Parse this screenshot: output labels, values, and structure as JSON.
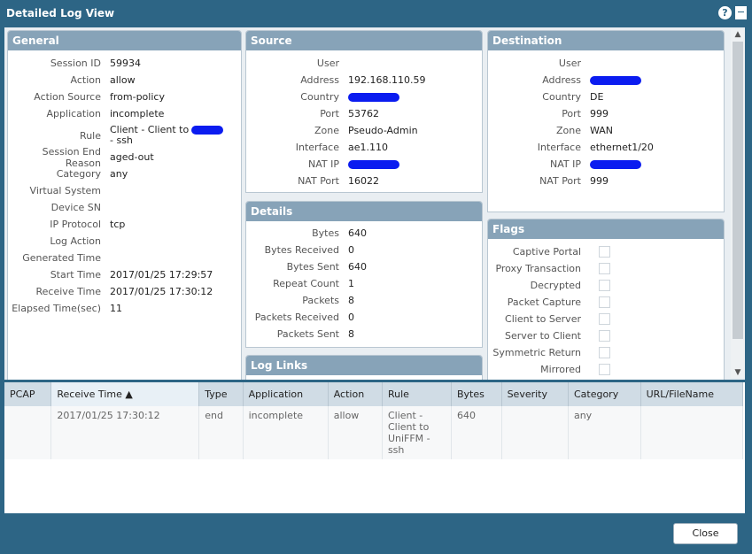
{
  "window": {
    "title": "Detailed Log View"
  },
  "general": {
    "title": "General",
    "rows": [
      {
        "label": "Session ID",
        "value": "59934"
      },
      {
        "label": "Action",
        "value": "allow"
      },
      {
        "label": "Action Source",
        "value": "from-policy"
      },
      {
        "label": "Application",
        "value": "incomplete"
      },
      {
        "label": "Rule",
        "value": "Client - Client to",
        "value2": "- ssh",
        "redacted": true
      },
      {
        "label": "Session End Reason",
        "value": "aged-out"
      },
      {
        "label": "Category",
        "value": "any"
      },
      {
        "label": "Virtual System",
        "value": ""
      },
      {
        "label": "Device SN",
        "value": ""
      },
      {
        "label": "IP Protocol",
        "value": "tcp"
      },
      {
        "label": "Log Action",
        "value": ""
      },
      {
        "label": "Generated Time",
        "value": ""
      },
      {
        "label": "Start Time",
        "value": "2017/01/25 17:29:57"
      },
      {
        "label": "Receive Time",
        "value": "2017/01/25 17:30:12"
      },
      {
        "label": "Elapsed Time(sec)",
        "value": "11"
      }
    ]
  },
  "source": {
    "title": "Source",
    "rows": [
      {
        "label": "User",
        "value": ""
      },
      {
        "label": "Address",
        "value": "192.168.110.59"
      },
      {
        "label": "Country",
        "value": "",
        "redacted": true
      },
      {
        "label": "Port",
        "value": "53762"
      },
      {
        "label": "Zone",
        "value": "Pseudo-Admin"
      },
      {
        "label": "Interface",
        "value": "ae1.110"
      },
      {
        "label": "NAT IP",
        "value": "",
        "redacted": true
      },
      {
        "label": "NAT Port",
        "value": "16022"
      }
    ]
  },
  "destination": {
    "title": "Destination",
    "rows": [
      {
        "label": "User",
        "value": ""
      },
      {
        "label": "Address",
        "value": "",
        "redacted": true
      },
      {
        "label": "Country",
        "value": "DE"
      },
      {
        "label": "Port",
        "value": "999"
      },
      {
        "label": "Zone",
        "value": "WAN"
      },
      {
        "label": "Interface",
        "value": "ethernet1/20"
      },
      {
        "label": "NAT IP",
        "value": "",
        "redacted": true
      },
      {
        "label": "NAT Port",
        "value": "999"
      }
    ]
  },
  "details": {
    "title": "Details",
    "rows": [
      {
        "label": "Bytes",
        "value": "640"
      },
      {
        "label": "Bytes Received",
        "value": "0"
      },
      {
        "label": "Bytes Sent",
        "value": "640"
      },
      {
        "label": "Repeat Count",
        "value": "1"
      },
      {
        "label": "Packets",
        "value": "8"
      },
      {
        "label": "Packets Received",
        "value": "0"
      },
      {
        "label": "Packets Sent",
        "value": "8"
      }
    ]
  },
  "log_links": {
    "title": "Log Links"
  },
  "flags": {
    "title": "Flags",
    "items": [
      {
        "label": "Captive Portal",
        "checked": false
      },
      {
        "label": "Proxy Transaction",
        "checked": false
      },
      {
        "label": "Decrypted",
        "checked": false
      },
      {
        "label": "Packet Capture",
        "checked": false
      },
      {
        "label": "Client to Server",
        "checked": false
      },
      {
        "label": "Server to Client",
        "checked": false
      },
      {
        "label": "Symmetric Return",
        "checked": false
      },
      {
        "label": "Mirrored",
        "checked": false
      }
    ]
  },
  "table": {
    "columns": [
      "PCAP",
      "Receive Time ▲",
      "Type",
      "Application",
      "Action",
      "Rule",
      "Bytes",
      "Severity",
      "Category",
      "URL/FileName"
    ],
    "rows": [
      [
        "",
        "2017/01/25 17:30:12",
        "end",
        "incomplete",
        "allow",
        "Client - Client to UniFFM - ssh",
        "640",
        "",
        "any",
        ""
      ]
    ]
  },
  "buttons": {
    "close": "Close"
  }
}
